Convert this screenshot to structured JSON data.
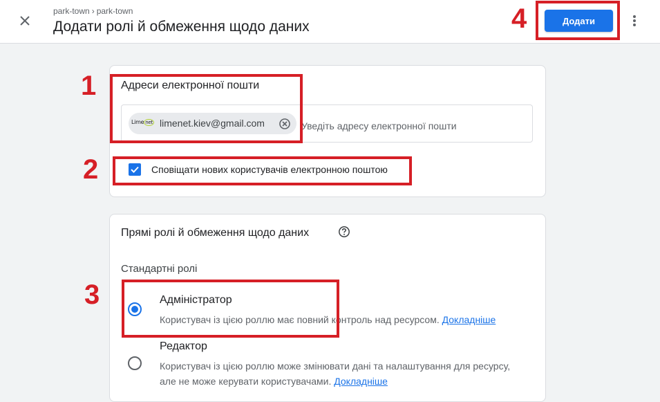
{
  "header": {
    "breadcrumb": [
      "park-town",
      "park-town"
    ],
    "breadcrumb_separator": "›",
    "title": "Додати ролі й обмеження щодо даних",
    "add_label": "Додати",
    "icons": {
      "close": "close-icon",
      "more": "more-vert-icon"
    }
  },
  "emails": {
    "label": "Адреси електронної пошти",
    "chip_logo": [
      "Lime",
      "net"
    ],
    "chip_email": "limenet.kiev@gmail.com",
    "input_placeholder": "Уведіть адресу електронної пошти"
  },
  "notify": {
    "checked": true,
    "label": "Сповіщати нових користувачів електронною поштою"
  },
  "roles": {
    "heading": "Прямі ролі й обмеження щодо даних",
    "standard_label": "Стандартні ролі",
    "items": [
      {
        "title": "Адміністратор",
        "desc": "Користувач із цією роллю має повний контроль над ресурсом.",
        "desc_line2": "",
        "link": "Докладніше",
        "selected": true
      },
      {
        "title": "Редактор",
        "desc": "Користувач із цією роллю може змінювати дані та налаштування для ресурсу,",
        "desc_line2": "але не може керувати користувачами.",
        "link": "Докладніше",
        "selected": false
      }
    ]
  },
  "annotations": [
    "1",
    "2",
    "3",
    "4"
  ],
  "colors": {
    "accent": "#1a73e8",
    "annotation": "#d61f26",
    "background": "#f1f3f4"
  }
}
